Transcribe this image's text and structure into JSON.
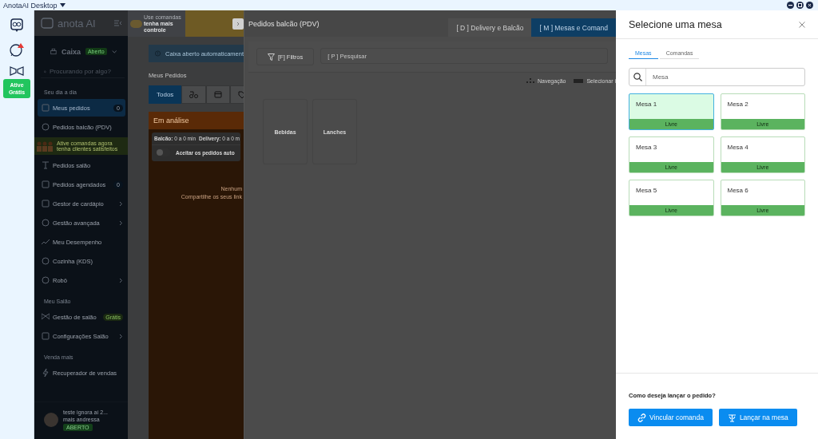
{
  "title_bar": {
    "title": "AnotaAI Desktop"
  },
  "rail": {
    "promo_badge": "Ative Grátis"
  },
  "sidebar": {
    "logo": "anota AI",
    "cashier": {
      "label": "Caixa",
      "status": "Aberto"
    },
    "search": {
      "placeholder": "Procurando por algo?"
    },
    "sections": [
      {
        "title": "Seu dia a dia",
        "items": [
          {
            "kind": "item",
            "label": "Meus pedidos",
            "selected": true,
            "count": "0",
            "has_submenu": false
          },
          {
            "kind": "item",
            "label": "Pedidos balcão (PDV)",
            "selected": false,
            "has_submenu": false
          },
          {
            "kind": "promo",
            "line_1": "Ative comandas agora",
            "line_2": "tenha clientes satisfeitos"
          },
          {
            "kind": "item",
            "label": "Pedidos salão",
            "selected": false,
            "has_submenu": false
          },
          {
            "kind": "item",
            "label": "Pedidos agendados",
            "selected": false,
            "count": "0",
            "has_submenu": false
          },
          {
            "kind": "item",
            "label": "Gestor de cardápio",
            "selected": false,
            "has_submenu": true
          },
          {
            "kind": "item",
            "label": "Gestão avançada",
            "selected": false,
            "has_submenu": true
          },
          {
            "kind": "item",
            "label": "Meu Desempenho",
            "selected": false,
            "has_submenu": false
          },
          {
            "kind": "item",
            "label": "Cozinha (KDS)",
            "selected": false,
            "has_submenu": false
          },
          {
            "kind": "item",
            "label": "Robô",
            "selected": false,
            "has_submenu": true
          }
        ]
      },
      {
        "title": "Meu Salão",
        "items": [
          {
            "kind": "item",
            "label": "Gestão de salão",
            "selected": false,
            "badge": "Grátis",
            "has_submenu": false
          },
          {
            "kind": "item",
            "label": "Configurações Salão",
            "selected": false,
            "has_submenu": true
          }
        ]
      },
      {
        "title": "Venda mais",
        "items": [
          {
            "kind": "item",
            "label": "Recuperador de vendas",
            "selected": false,
            "has_submenu": false
          }
        ]
      }
    ],
    "user": {
      "name": "teste ignora aí 2...",
      "subtitle": "mais andressa",
      "status": "ABERTO"
    }
  },
  "orders": {
    "banner": {
      "line_1": "Use comandas",
      "line_2": "tenha mais controle"
    },
    "alert": "Caixa aberto automaticament",
    "heading": "Meus Pedidos",
    "filters": [
      {
        "kind": "text",
        "label": "Todos",
        "selected": true
      },
      {
        "kind": "delivery",
        "selected": false
      },
      {
        "kind": "store",
        "selected": false
      },
      {
        "kind": "tag",
        "selected": false
      }
    ],
    "column": {
      "title": "Em análise",
      "times": [
        {
          "label": "Balcão:",
          "value": "0 a 0 min"
        },
        {
          "label": "Delivery:",
          "value": "0 a 0 m"
        }
      ],
      "auto_accept": {
        "label": "Aceitar os pedidos auto",
        "on": false
      },
      "empty_lines": [
        "Nenhum",
        "Compartilhe os seus link"
      ]
    }
  },
  "drawer": {
    "title": "Pedidos balcão (PDV)",
    "modes": [
      {
        "label": "[ D ] Delivery e Balcão",
        "selected": false
      },
      {
        "label": "[ M ] Mesas e Comand",
        "selected": true
      }
    ],
    "filter_button": "[F] Filtros",
    "search": {
      "placeholder": "[ P ] Pesquisar"
    },
    "hints": [
      {
        "kind": "arrows",
        "label": "Navegação"
      },
      {
        "kind": "enter",
        "label": "Selecionar i"
      }
    ],
    "categories": [
      "Bebidas",
      "Lanches"
    ]
  },
  "panel": {
    "title": "Selecione uma mesa",
    "tabs": [
      {
        "label": "Mesas",
        "selected": true
      },
      {
        "label": "Comandas",
        "selected": false
      }
    ],
    "search": {
      "placeholder": "Mesa"
    },
    "tables": [
      {
        "name": "Mesa 1",
        "status": "Livre",
        "selected": true
      },
      {
        "name": "Mesa 2",
        "status": "Livre",
        "selected": false
      },
      {
        "name": "Mesa 3",
        "status": "Livre",
        "selected": false
      },
      {
        "name": "Mesa 4",
        "status": "Livre",
        "selected": false
      },
      {
        "name": "Mesa 5",
        "status": "Livre",
        "selected": false
      },
      {
        "name": "Mesa 6",
        "status": "Livre",
        "selected": false
      }
    ],
    "footer": {
      "question": "Como deseja lançar o pedido?",
      "buttons": [
        {
          "kind": "link",
          "label": "Vincular comanda"
        },
        {
          "kind": "table",
          "label": "Lançar na mesa"
        }
      ]
    }
  }
}
